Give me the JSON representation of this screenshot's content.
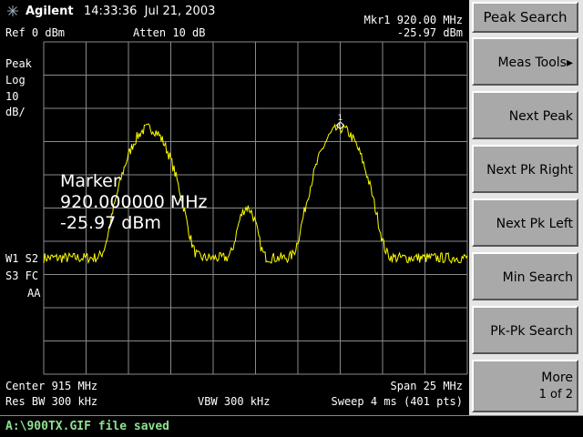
{
  "header": {
    "brand": "Agilent",
    "time": "14:33:36",
    "date": "Jul 21, 2003"
  },
  "display": {
    "ref_level": "Ref 0 dBm",
    "attenuation": "Atten 10 dB",
    "marker_header": "Mkr1  920.00 MHz",
    "marker_amplitude": "-25.97 dBm",
    "detector": "Peak",
    "scale_type": "Log",
    "scale_value": "10",
    "scale_unit": "dB/",
    "trace_line1": "W1  S2",
    "trace_line2": "S3  FC",
    "trace_line3": "AA",
    "center": "Center 915 MHz",
    "span": "Span 25 MHz",
    "res_bw": "Res BW 300 kHz",
    "vbw": "VBW 300 kHz",
    "sweep": "Sweep 4 ms (401 pts)",
    "marker_label": "1",
    "readout_title": "Marker",
    "readout_freq": "920.000000 MHz",
    "readout_amp": "-25.97 dBm"
  },
  "softkeys": {
    "title": "Peak Search",
    "items": [
      {
        "label": "Meas Tools▸"
      },
      {
        "label": "Next Peak"
      },
      {
        "label": "Next Pk Right"
      },
      {
        "label": "Next Pk Left"
      },
      {
        "label": "Min Search"
      },
      {
        "label": "Pk-Pk Search"
      },
      {
        "label": "More",
        "sub": "1 of 2"
      }
    ]
  },
  "status": {
    "message": "A:\\900TX.GIF file saved"
  },
  "colors": {
    "trace": "#ffff00",
    "grid": "#8a8a8a",
    "status_text": "#8fe08f",
    "softkey_bg": "#a9a9a9"
  },
  "chart_data": {
    "type": "line",
    "x_unit": "MHz",
    "y_unit": "dBm",
    "xlim": [
      902.5,
      927.5
    ],
    "ylim": [
      -100,
      0
    ],
    "noise_floor": -65,
    "peaks": [
      {
        "freq": 908.7,
        "amp": -26
      },
      {
        "freq": 914.5,
        "amp": -50
      },
      {
        "freq": 920.0,
        "amp": -25.97
      }
    ],
    "marker": {
      "label": "1",
      "freq": 920.0,
      "amp": -25.97
    }
  }
}
